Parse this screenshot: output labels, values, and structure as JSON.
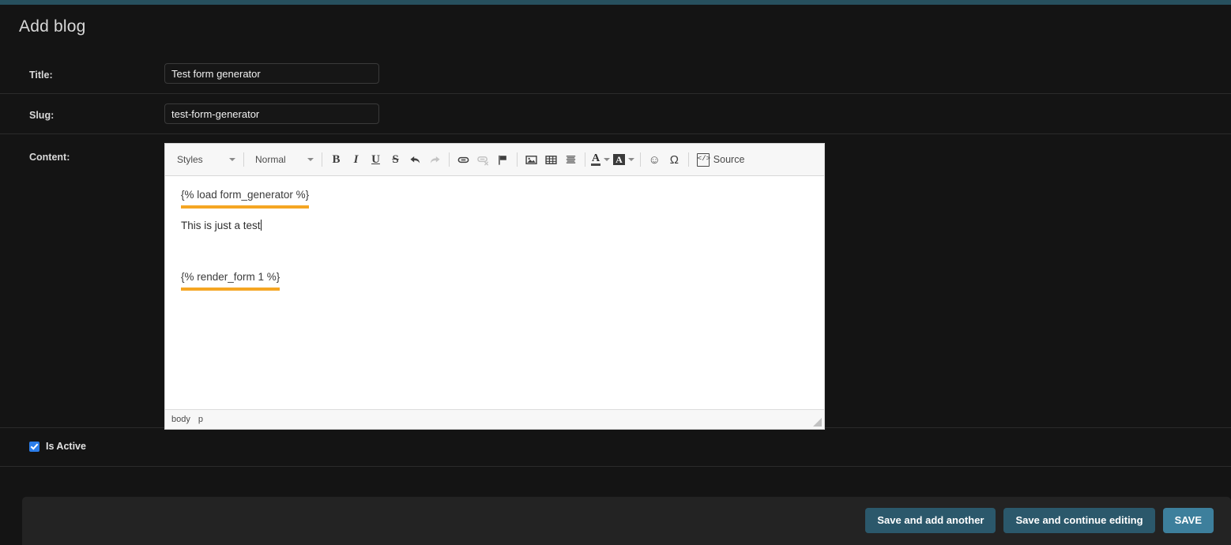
{
  "theme": {
    "accent_strip": "#27505e",
    "page_bg": "#141414",
    "checkbox_accent": "#2b7de9",
    "tag_underline": "#f5a623",
    "button_secondary": "#2b586b",
    "button_primary": "#3d7f9c"
  },
  "header": {
    "title": "Add blog"
  },
  "form": {
    "title_field": {
      "label": "Title:",
      "value": "Test form generator",
      "placeholder": ""
    },
    "slug_field": {
      "label": "Slug:",
      "value": "test-form-generator",
      "placeholder": ""
    },
    "content_field": {
      "label": "Content:"
    },
    "is_active": {
      "label": "Is Active",
      "checked": true
    }
  },
  "editor": {
    "toolbar": {
      "styles_combo": "Styles",
      "format_combo": "Normal",
      "bold": "B",
      "italic": "I",
      "underline": "U",
      "strike": "S",
      "undo": "undo-icon",
      "redo": "redo-icon",
      "link": "link-icon",
      "unlink": "unlink-icon",
      "anchor": "flag-icon",
      "image": "image-icon",
      "table": "table-icon",
      "horizontal_rule": "horizontal-rule-icon",
      "text_color_glyph": "A",
      "background_color_glyph": "A",
      "smiley": "☺",
      "special_char": "Ω",
      "source_label": "Source"
    },
    "content": {
      "line_1": "{% load form_generator %}",
      "line_2": "This is just a test",
      "line_3": "{% render_form 1 %}"
    },
    "status_path": [
      "body",
      "p"
    ]
  },
  "submit_row": {
    "save_and_add_another": "Save and add another",
    "save_and_continue_editing": "Save and continue editing",
    "save": "SAVE"
  }
}
